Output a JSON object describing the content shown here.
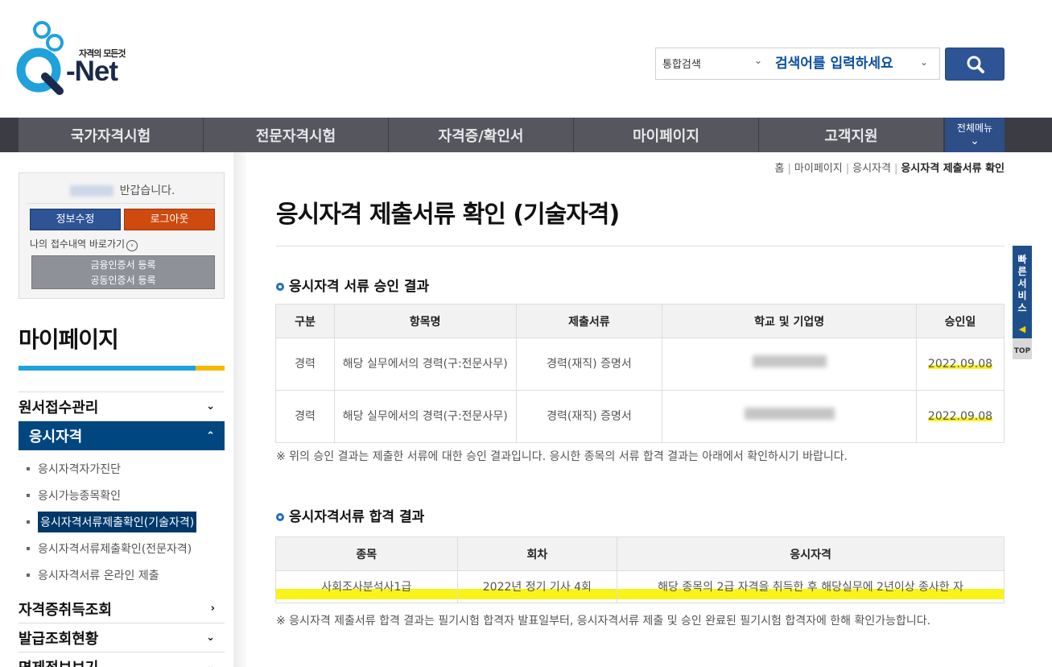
{
  "header": {
    "logo_tagline": "자격의 모든것",
    "logo_text": "-Net",
    "search_category": "통합검색",
    "search_placeholder": "검색어를 입력하세요"
  },
  "nav": {
    "items": [
      "국가자격시험",
      "전문자격시험",
      "자격증/확인서",
      "마이페이지",
      "고객지원"
    ],
    "all_menu": "전체메뉴"
  },
  "sidebar": {
    "welcome": "반갑습니다.",
    "edit_info": "정보수정",
    "logout": "로그아웃",
    "quick_link": "나의 접수내역 바로가기",
    "cert_line1": "금융인증서 등록",
    "cert_line2": "공동인증서 등록",
    "title": "마이페이지",
    "menu": {
      "apply": "원서접수관리",
      "qualification": "응시자격",
      "sub_items": [
        "응시자격자가진단",
        "응시가능종목확인",
        "응시자격서류제출확인(기술자격)",
        "응시자격서류제출확인(전문자격)",
        "응시자격서류 온라인 제출"
      ],
      "cert_lookup": "자격증취득조회",
      "issue_status": "발급조회현황",
      "exempt": "면제정보보기"
    }
  },
  "breadcrumb": {
    "home": "홈",
    "mypage": "마이페이지",
    "qual": "응시자격",
    "current": "응시자격 제출서류 확인"
  },
  "page_title": "응시자격 제출서류 확인 (기술자격)",
  "section1": {
    "heading": "응시자격 서류 승인 결과",
    "columns": [
      "구분",
      "항목명",
      "제출서류",
      "학교 및 기업명",
      "승인일"
    ],
    "rows": [
      {
        "type": "경력",
        "item": "해당 실무에서의 경력(구:전문사무)",
        "doc": "경력(재직) 증명서",
        "date": "2022.09.08"
      },
      {
        "type": "경력",
        "item": "해당 실무에서의 경력(구:전문사무)",
        "doc": "경력(재직) 증명서",
        "date": "2022.09.08"
      }
    ],
    "note": "※ 위의 승인 결과는 제출한 서류에 대한 승인 결과입니다. 응시한 종목의 서류 합격 결과는 아래에서 확인하시기 바랍니다."
  },
  "section2": {
    "heading": "응시자격서류 합격 결과",
    "columns": [
      "종목",
      "회차",
      "응시자격"
    ],
    "row": {
      "subject": "사회조사분석사1급",
      "round": "2022년 정기 기사 4회",
      "qualification": "해당 종목의 2급 자격을 취득한 후 해당실무에 2년이상 종사한 자"
    },
    "note": "※ 응시자격 제출서류 합격 결과는 필기시험 합격자 발표일부터, 응시자격서류 제출 및 승인 완료된 필기시험 합격자에 한해 확인가능합니다."
  },
  "quick_service": {
    "label": "빠른서비스",
    "top": "TOP"
  }
}
